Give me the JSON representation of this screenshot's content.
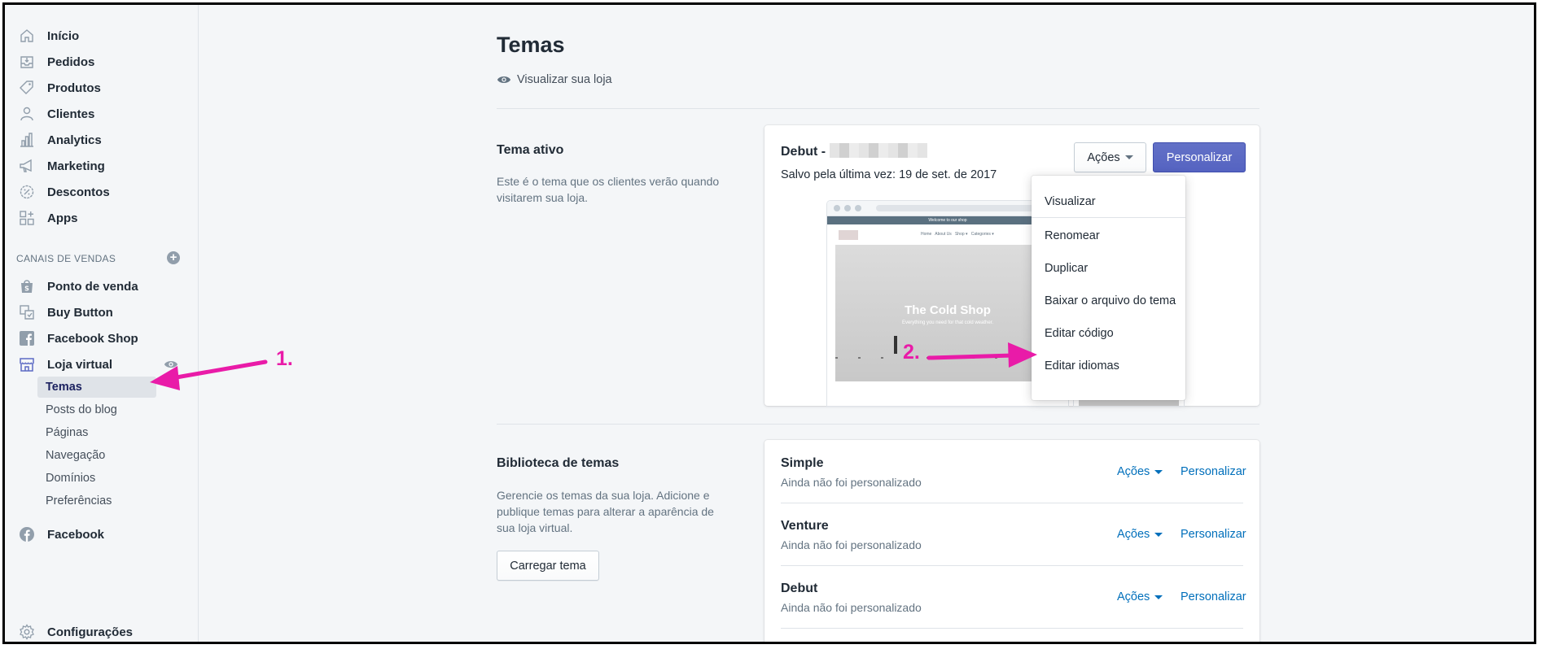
{
  "sidebar": {
    "items": [
      {
        "label": "Início",
        "icon": "home-icon"
      },
      {
        "label": "Pedidos",
        "icon": "orders-icon"
      },
      {
        "label": "Produtos",
        "icon": "tag-icon"
      },
      {
        "label": "Clientes",
        "icon": "person-icon"
      },
      {
        "label": "Analytics",
        "icon": "bar-chart-icon"
      },
      {
        "label": "Marketing",
        "icon": "megaphone-icon"
      },
      {
        "label": "Descontos",
        "icon": "discount-icon"
      },
      {
        "label": "Apps",
        "icon": "apps-icon"
      }
    ],
    "channels_heading": "CANAIS DE VENDAS",
    "channels": [
      {
        "label": "Ponto de venda",
        "icon": "shopping-bag-icon"
      },
      {
        "label": "Buy Button",
        "icon": "buy-button-icon"
      },
      {
        "label": "Facebook Shop",
        "icon": "facebook-square-icon"
      },
      {
        "label": "Loja virtual",
        "icon": "store-icon"
      }
    ],
    "store_subitems": [
      "Temas",
      "Posts do blog",
      "Páginas",
      "Navegação",
      "Domínios",
      "Preferências"
    ],
    "facebook": {
      "label": "Facebook",
      "icon": "facebook-circle-icon"
    },
    "settings": {
      "label": "Configurações",
      "icon": "gear-icon"
    }
  },
  "page": {
    "title": "Temas",
    "view_store": "Visualizar sua loja"
  },
  "active_theme": {
    "section_title": "Tema ativo",
    "section_desc": "Este é o tema que os clientes verão quando visitarem sua loja.",
    "theme_name": "Debut -",
    "saved": "Salvo pela última vez: 19 de set. de 2017",
    "actions_label": "Ações",
    "customize_label": "Personalizar",
    "preview": {
      "banner": "Welcome to our shop",
      "hero_title": "The Cold Shop",
      "hero_subtitle": "Everything you need for that cold weather.",
      "nav_links": "Home   About Us   Shop ▾   Categories ▾"
    },
    "dropdown": [
      "Visualizar",
      "Renomear",
      "Duplicar",
      "Baixar o arquivo do tema",
      "Editar código",
      "Editar idiomas"
    ]
  },
  "library": {
    "section_title": "Biblioteca de temas",
    "section_desc": "Gerencie os temas da sua loja. Adicione e publique temas para alterar a aparência de sua loja virtual.",
    "upload_label": "Carregar tema",
    "themes": [
      {
        "name": "Simple",
        "status": "Ainda não foi personalizado",
        "actions": "Ações",
        "customize": "Personalizar"
      },
      {
        "name": "Venture",
        "status": "Ainda não foi personalizado",
        "actions": "Ações",
        "customize": "Personalizar"
      },
      {
        "name": "Debut",
        "status": "Ainda não foi personalizado",
        "actions": "Ações",
        "customize": "Personalizar"
      }
    ]
  },
  "annotations": {
    "one": "1.",
    "two": "2."
  },
  "colors": {
    "accent": "#5c6ac4",
    "link": "#006fbb",
    "annotation": "#e91ba8",
    "sidebar_bg": "#f4f6f8"
  }
}
